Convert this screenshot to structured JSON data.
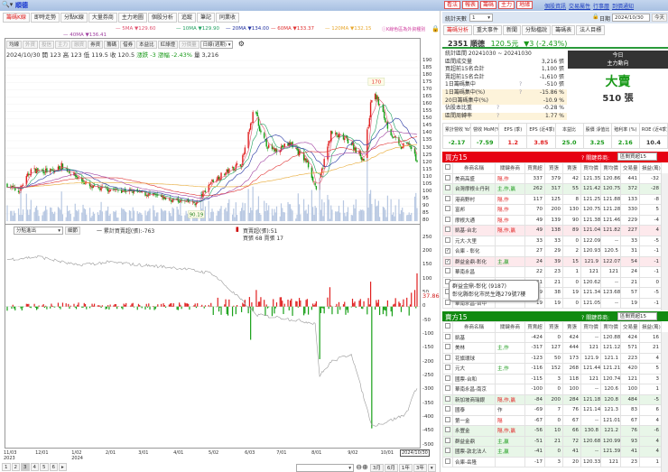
{
  "header": {
    "search_icon": "magnifier",
    "title": "順德",
    "buttons": [
      "看法",
      "報表",
      "籌碼",
      "主力",
      "地緣"
    ],
    "links": [
      "個股資訊",
      "交易屬性",
      "行事曆",
      "到價通知"
    ]
  },
  "left_tabs": [
    "籌碼K線",
    "即時走勢",
    "分點K線",
    "大量券商",
    "主力地圖",
    "個股分析",
    "追蹤",
    "筆記",
    "同業收"
  ],
  "ma_legend": [
    {
      "label": "5MA ▼129.60",
      "color": "#e0506e"
    },
    {
      "label": "10MA ▼129.90",
      "color": "#20a060"
    },
    {
      "label": "20MA ▼134.00",
      "color": "#2030a0"
    },
    {
      "label": "60MA ▼133.37",
      "color": "#e03030"
    },
    {
      "label": "120MA ▼132.15",
      "color": "#e8a830"
    },
    {
      "label": "40MA ▼136.41",
      "color": "#a040a0"
    }
  ],
  "info_note": "ⓘK線色區為外資種別",
  "toolbar": {
    "buttons": [
      {
        "label": "均線",
        "on": true
      },
      {
        "label": "外資",
        "on": false
      },
      {
        "label": "投信",
        "on": false
      },
      {
        "label": "主力",
        "on": false
      },
      {
        "label": "融資",
        "on": false
      },
      {
        "label": "券資",
        "on": true
      },
      {
        "label": "籌碼",
        "on": true
      },
      {
        "label": "借券",
        "on": true
      },
      {
        "label": "本益比",
        "on": true
      },
      {
        "label": "紅綠燈",
        "on": true
      },
      {
        "label": "分價量",
        "on": false
      }
    ],
    "period": "日線(週期)"
  },
  "quote_line": {
    "date": "2024/10/30",
    "open": "開 123",
    "high": "高 123",
    "low": "低 119.5",
    "close": "收 120.5",
    "change": "漲跌 -3",
    "pct": "漲幅 -2.43%",
    "vol": "量 3,216"
  },
  "lower_controls": {
    "select": "分點進出",
    "button": "細節",
    "cum_label": "一 累計買賣超(張):-763",
    "net_label": "買賣超(張):51",
    "buy_sell": "買張 68 賣張 17"
  },
  "chart_data": {
    "type": "candlestick",
    "price_axis": {
      "range": [
        80,
        190
      ],
      "ticks": [
        190,
        185,
        180,
        175,
        170,
        165,
        160,
        155,
        150,
        145,
        140,
        135,
        130,
        125,
        120,
        115,
        110,
        105,
        100,
        95,
        90,
        85,
        80
      ]
    },
    "annotations": [
      {
        "label": "170",
        "date": "2024/09/24",
        "price": 170
      },
      {
        "label": "90.19",
        "date": "2024/04/18",
        "price": 90.19
      }
    ],
    "close_waypoints": [
      [
        "2023/11/03",
        105
      ],
      [
        "2023/11/13",
        100
      ],
      [
        "2023/11/24",
        115
      ],
      [
        "2023/12/14",
        114
      ],
      [
        "2023/12/21",
        118
      ],
      [
        "2024/01/16",
        103
      ],
      [
        "2024/02/25",
        100
      ],
      [
        "2024/03/25",
        95
      ],
      [
        "2024/04/18",
        92
      ],
      [
        "2024/05/01",
        107
      ],
      [
        "2024/05/28",
        120
      ],
      [
        "2024/06/05",
        145
      ],
      [
        "2024/06/09",
        160
      ],
      [
        "2024/06/13",
        140
      ],
      [
        "2024/06/23",
        128
      ],
      [
        "2024/07/11",
        133
      ],
      [
        "2024/07/25",
        120
      ],
      [
        "2024/08/03",
        100
      ],
      [
        "2024/08/07",
        115
      ],
      [
        "2024/08/15",
        140
      ],
      [
        "2024/08/31",
        135
      ],
      [
        "2024/09/13",
        122
      ],
      [
        "2024/09/20",
        165
      ],
      [
        "2024/09/24",
        165
      ],
      [
        "2024/10/05",
        143
      ],
      [
        "2024/10/15",
        130
      ],
      [
        "2024/10/23",
        133
      ],
      [
        "2024/10/30",
        120.5
      ]
    ],
    "start": "2023/11/03",
    "end": "2024/10/30",
    "x_ticks": [
      [
        "11/03",
        "2023"
      ],
      [
        "12/01",
        ""
      ],
      [
        "1/02",
        "2024"
      ],
      [
        "2/01",
        ""
      ],
      [
        "3/01",
        ""
      ],
      [
        "4/01",
        ""
      ],
      [
        "5/02",
        ""
      ],
      [
        "6/03",
        ""
      ],
      [
        "7/01",
        ""
      ],
      [
        "8/01",
        ""
      ],
      [
        "9/02",
        ""
      ],
      [
        "10/01",
        ""
      ]
    ],
    "x_tick_dates": [
      "2023/11/03",
      "2023/12/01",
      "2024/01/02",
      "2024/02/01",
      "2024/03/01",
      "2024/04/01",
      "2024/05/02",
      "2024/06/03",
      "2024/07/01",
      "2024/08/01",
      "2024/09/02",
      "2024/10/01"
    ],
    "last_date_label": "2024/10/30",
    "lower_axis": {
      "range": [
        -500,
        250
      ],
      "ticks": [
        250,
        200,
        150,
        100,
        50,
        0,
        -50,
        -100,
        -150,
        -200,
        -250,
        -300,
        -350,
        -400,
        -450,
        -500
      ],
      "last_value": "37.86"
    },
    "cumulative_waypoints": [
      [
        "2023/11/03",
        170
      ],
      [
        "2023/12/01",
        180
      ],
      [
        "2024/01/02",
        150
      ],
      [
        "2024/02/01",
        160
      ],
      [
        "2024/03/01",
        150
      ],
      [
        "2024/04/01",
        140
      ],
      [
        "2024/05/02",
        120
      ],
      [
        "2024/06/03",
        0
      ],
      [
        "2024/06/10",
        -30
      ],
      [
        "2024/07/01",
        -40
      ],
      [
        "2024/08/01",
        -60
      ],
      [
        "2024/08/05",
        -250
      ],
      [
        "2024/08/15",
        -200
      ],
      [
        "2024/09/02",
        -170
      ],
      [
        "2024/09/20",
        -430
      ],
      [
        "2024/10/01",
        -420
      ],
      [
        "2024/10/20",
        -390
      ],
      [
        "2024/10/30",
        -290
      ]
    ],
    "net_spikes": [
      [
        "2024/06/05",
        -120
      ],
      [
        "2024/06/10",
        60
      ],
      [
        "2024/08/05",
        -190
      ],
      [
        "2024/08/14",
        70
      ],
      [
        "2024/09/20",
        -440
      ],
      [
        "2024/09/19",
        90
      ],
      [
        "2024/10/25",
        50
      ],
      [
        "2024/10/28",
        60
      ],
      [
        "2024/10/30",
        120
      ]
    ]
  },
  "pager": {
    "pages": [
      "1",
      "2",
      "3",
      "4",
      "5",
      "6"
    ],
    "current": "3",
    "ranges": [
      "3月",
      "6月",
      "1年",
      "3年"
    ]
  },
  "right": {
    "days_label": "統計天數",
    "days_value": "1",
    "date_label": "日期",
    "date_value": "2024/10/30",
    "today": "今天",
    "tabs": [
      "籌碼分析",
      "重大事件",
      "新聞",
      "分點檔說",
      "籌碼表",
      "法人目標"
    ],
    "stock": {
      "code_name": "2351 順德",
      "price": "120.5元",
      "change": "▼3 (-2.43%)"
    },
    "stats": [
      [
        "統計區間  20241030 ~ 20241030",
        ""
      ],
      [
        "區間成交量",
        "3,216 張"
      ],
      [
        "買超前15名合計",
        "1,100 張"
      ],
      [
        "賣超前15名合計",
        "-1,610 張"
      ],
      [
        "1日籌碼集中",
        "-510 張"
      ],
      [
        "1日籌碼集中(%)",
        "-15.86 %"
      ],
      [
        "20日籌碼集中(%)",
        "-10.9 %"
      ],
      [
        "佔股本比重",
        "-0.28 %"
      ],
      [
        "區間周轉率",
        "1.77 %"
      ]
    ],
    "trend": {
      "title1": "今日",
      "title2": "主力動向",
      "big": "大賣",
      "amount": "510 張"
    },
    "metrics": [
      {
        "h": "累計營收 YoY(%)",
        "v": "-2.17",
        "c": "g"
      },
      {
        "h": "營收 MoM(%)",
        "v": "-7.59",
        "c": "g"
      },
      {
        "h": "EPS (季)",
        "v": "1.2",
        "c": "r"
      },
      {
        "h": "EPS (近4季)",
        "v": "3.85",
        "c": "r"
      },
      {
        "h": "本益比",
        "v": "25.0",
        "c": "g"
      },
      {
        "h": "股價 淨值比",
        "v": "3.25",
        "c": "g"
      },
      {
        "h": "殖利率 (%)",
        "v": "2.16",
        "c": "g"
      },
      {
        "h": "ROE (近4季)",
        "v": "10.4",
        "c": ""
      }
    ],
    "filter_label": "? 關鍵券商:",
    "filter_value": "區間買超15",
    "columns": [
      "券商名稱",
      "關鍵券商",
      "買賣超",
      "買張",
      "賣張",
      "買均價",
      "賣均價",
      "交易量",
      "損益(萬)"
    ],
    "buy_title": "買方15",
    "buy_rows": [
      {
        "c": false,
        "hl": "",
        "n": "美商高盛",
        "t": "隔,作",
        "tc": "r",
        "v": [
          "337",
          "379",
          "42",
          "121.35",
          "120.86",
          "441",
          "-32"
        ]
      },
      {
        "c": false,
        "hl": "g",
        "n": "台灣摩根士丹利",
        "t": "主,作,贏",
        "tc": "g",
        "v": [
          "262",
          "317",
          "55",
          "121.42",
          "120.75",
          "372",
          "-28"
        ]
      },
      {
        "c": false,
        "hl": "",
        "n": "港商野村",
        "t": "隔,作",
        "tc": "r",
        "v": [
          "117",
          "125",
          "8",
          "121.25",
          "121.88",
          "133",
          "-8"
        ]
      },
      {
        "c": false,
        "hl": "",
        "n": "富邦",
        "t": "隔,作",
        "tc": "r",
        "v": [
          "70",
          "200",
          "130",
          "120.75",
          "121.28",
          "330",
          "5"
        ]
      },
      {
        "c": false,
        "hl": "",
        "n": "摩根大通",
        "t": "隔,作",
        "tc": "r",
        "v": [
          "49",
          "139",
          "90",
          "121.38",
          "121.46",
          "229",
          "-4"
        ]
      },
      {
        "c": false,
        "hl": "p",
        "n": "凱基-台北",
        "t": "隔,作,贏",
        "tc": "r",
        "v": [
          "49",
          "138",
          "89",
          "121.04",
          "121.82",
          "227",
          "4"
        ]
      },
      {
        "c": false,
        "hl": "",
        "n": "元大-大里",
        "t": "",
        "tc": "",
        "v": [
          "33",
          "33",
          "0",
          "122.09",
          "--",
          "33",
          "-5"
        ]
      },
      {
        "c": true,
        "hl": "",
        "n": "合庫 - 彰化",
        "t": "",
        "tc": "",
        "v": [
          "27",
          "29",
          "2",
          "120.93",
          "120.5",
          "31",
          "-1"
        ]
      },
      {
        "c": true,
        "hl": "p",
        "n": "群益金鼎-彰化",
        "t": "主,贏",
        "tc": "g",
        "v": [
          "24",
          "39",
          "15",
          "121.9",
          "122.07",
          "54",
          "-1"
        ]
      },
      {
        "c": false,
        "hl": "",
        "n": "華南永昌",
        "t": "",
        "tc": "",
        "v": [
          "22",
          "23",
          "1",
          "121",
          "121",
          "24",
          "-1"
        ]
      },
      {
        "c": false,
        "hl": "",
        "n": "兆豐",
        "t": "",
        "tc": "",
        "v": [
          "21",
          "21",
          "0",
          "120.62",
          "--",
          "21",
          "0"
        ]
      },
      {
        "c": false,
        "hl": "",
        "n": "永豐金",
        "t": "",
        "tc": "",
        "v": [
          "19",
          "38",
          "19",
          "121.34",
          "123.68",
          "57",
          "-5"
        ]
      },
      {
        "c": false,
        "hl": "",
        "n": "華南永昌-台中",
        "t": "",
        "tc": "",
        "v": [
          "19",
          "19",
          "0",
          "121.05",
          "--",
          "19",
          "-1"
        ]
      }
    ],
    "tooltip": {
      "line1": "群益金鼎-彰化 (9187)",
      "line2": "彰化縣彰化市民生路279號7樓"
    },
    "sell_title": "賣方15",
    "sell_rows": [
      {
        "c": false,
        "hl": "",
        "n": "凱基",
        "t": "",
        "tc": "",
        "v": [
          "-424",
          "0",
          "424",
          "--",
          "120.88",
          "424",
          "16"
        ]
      },
      {
        "c": false,
        "hl": "",
        "n": "美林",
        "t": "主,作",
        "tc": "g",
        "v": [
          "-317",
          "127",
          "444",
          "121",
          "121.12",
          "571",
          "21"
        ]
      },
      {
        "c": false,
        "hl": "",
        "n": "花旗環球",
        "t": "",
        "tc": "",
        "v": [
          "-123",
          "50",
          "173",
          "121.9",
          "121.1",
          "223",
          "4"
        ]
      },
      {
        "c": false,
        "hl": "",
        "n": "元大",
        "t": "主,作",
        "tc": "g",
        "v": [
          "-116",
          "152",
          "268",
          "121.44",
          "121.21",
          "420",
          "5"
        ]
      },
      {
        "c": false,
        "hl": "",
        "n": "國票-台和",
        "t": "",
        "tc": "",
        "v": [
          "-115",
          "3",
          "118",
          "121",
          "120.74",
          "121",
          "3"
        ]
      },
      {
        "c": false,
        "hl": "",
        "n": "華南永昌-南京",
        "t": "",
        "tc": "",
        "v": [
          "-100",
          "0",
          "100",
          "--",
          "120.6",
          "100",
          "1"
        ]
      },
      {
        "c": false,
        "hl": "g",
        "n": "新加坡商瑞銀",
        "t": "隔,作,贏",
        "tc": "r",
        "v": [
          "-84",
          "200",
          "284",
          "121.18",
          "120.8",
          "484",
          "-5"
        ]
      },
      {
        "c": false,
        "hl": "",
        "n": "國泰",
        "t": "作",
        "tc": "",
        "v": [
          "-69",
          "7",
          "76",
          "121.14",
          "121.3",
          "83",
          "6"
        ]
      },
      {
        "c": false,
        "hl": "",
        "n": "第一金",
        "t": "隔",
        "tc": "r",
        "v": [
          "-67",
          "0",
          "67",
          "--",
          "121.01",
          "67",
          "4"
        ]
      },
      {
        "c": false,
        "hl": "g",
        "n": "永豐金",
        "t": "隔,作,贏",
        "tc": "r",
        "v": [
          "-56",
          "10",
          "66",
          "130.8",
          "121.2",
          "76",
          "-6"
        ]
      },
      {
        "c": false,
        "hl": "g",
        "n": "群益金鼎",
        "t": "主,贏",
        "tc": "g",
        "v": [
          "-51",
          "21",
          "72",
          "120.68",
          "120.99",
          "93",
          "4"
        ]
      },
      {
        "c": false,
        "hl": "g",
        "n": "國票-敦北法人",
        "t": "主,贏",
        "tc": "g",
        "v": [
          "-41",
          "0",
          "41",
          "--",
          "121.39",
          "41",
          "4"
        ]
      },
      {
        "c": false,
        "hl": "",
        "n": "合庫-岳隆",
        "t": "",
        "tc": "",
        "v": [
          "-17",
          "3",
          "20",
          "120.33",
          "121",
          "23",
          "1"
        ]
      }
    ]
  }
}
